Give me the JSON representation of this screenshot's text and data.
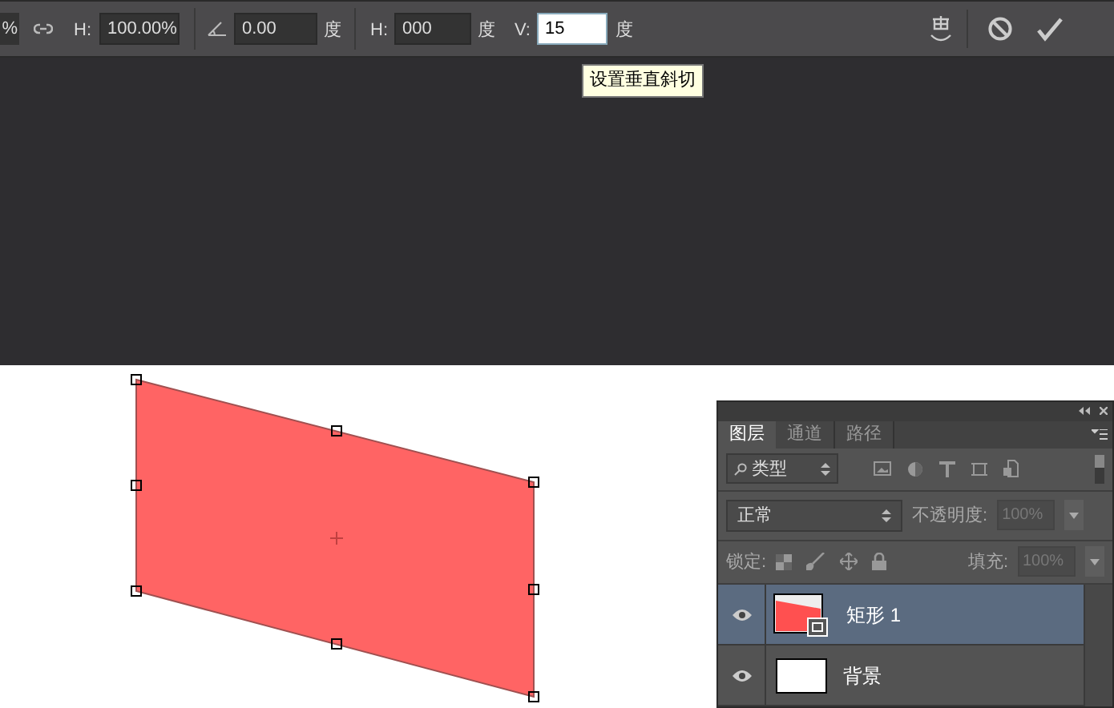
{
  "toolbar": {
    "width": {
      "value": "%"
    },
    "height": {
      "label": "H:",
      "value": "100.00%"
    },
    "rotate": {
      "value": "0.00",
      "unit": "度"
    },
    "h_skew": {
      "label": "H:",
      "value": "000",
      "unit": "度",
      "focused": false
    },
    "v_skew": {
      "label": "V:",
      "value": "15",
      "unit": "度",
      "focused": true
    }
  },
  "tooltip": "设置垂直斜切",
  "layers_panel": {
    "tabs": [
      {
        "label": "图层",
        "selected": true
      },
      {
        "label": "通道",
        "selected": false
      },
      {
        "label": "路径",
        "selected": false
      }
    ],
    "filter": {
      "value": "类型"
    },
    "blend_mode": {
      "value": "正常"
    },
    "opacity": {
      "label": "不透明度:",
      "value": "100%",
      "disabled": true
    },
    "lock": {
      "label": "锁定:"
    },
    "fill": {
      "label": "填充:",
      "value": "100%",
      "disabled": true
    },
    "layers": [
      {
        "name": "矩形 1",
        "kind": "shape",
        "selected": true,
        "visible": true
      },
      {
        "name": "背景",
        "kind": "background",
        "selected": false,
        "visible": true
      }
    ]
  }
}
